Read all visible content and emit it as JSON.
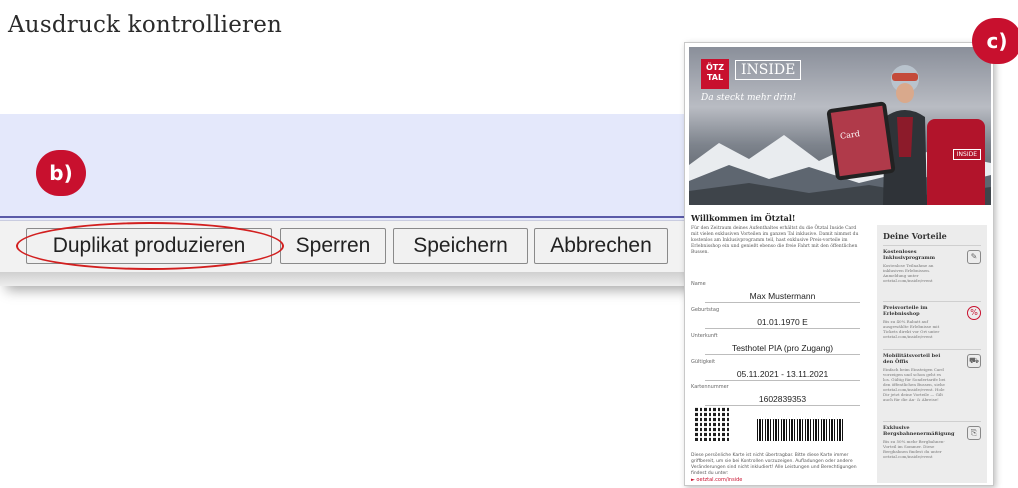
{
  "page": {
    "title": "Ausdruck kontrollieren"
  },
  "badges": {
    "b": "b)",
    "c": "c)"
  },
  "toolbar": {
    "duplicate_label": "Duplikat produzieren",
    "lock_label": "Sperren",
    "save_label": "Speichern",
    "cancel_label": "Abbrechen"
  },
  "colors": {
    "accent_red": "#c8102e",
    "panel_blue": "#e4e8fb",
    "rule_blue": "#5a5aa8"
  },
  "card": {
    "logo": "ÖTZ TAL",
    "brand": "INSIDE",
    "tagline": "Da steckt mehr drin!",
    "phone_label": "Card",
    "box_label": "INSIDE",
    "welcome": "Willkommen im Ötztal!",
    "intro": "Für den Zeitraum deines Aufenthaltes erhältst du die Ötztal Inside Card mit vielen exklusiven Vorteilen im ganzen Tal inklusive. Damit nimmst du kostenlos am Inklusivprogramm teil, hast exklusive Preis-vorteile im Erlebnisshop ein und genießt ebenso die freie Fahrt mit den öffentlichen Bussen.",
    "fields": [
      {
        "label": "Name",
        "value": "Max Mustermann"
      },
      {
        "label": "Geburtstag",
        "value": "01.01.1970   E"
      },
      {
        "label": "Unterkunft",
        "value": "Testhotel PIA (pro Zugang)"
      },
      {
        "label": "Gültigkeit",
        "value": "05.11.2021 - 13.11.2021"
      },
      {
        "label": "Kartennummer",
        "value": "1602839353"
      }
    ],
    "footer": "Diese persönliche Karte ist nicht übertragbar. Bitte diese Karte immer griffbereit, um sie bei Kontrollen vorzuzeigen. Aufladungen oder andere Veränderungen sind nicht inkludiert! Alle Leistungen und Berechtigungen findest du unter:",
    "link": "► oetztal.com/inside",
    "benefits_title": "Deine Vorteile",
    "benefits": [
      {
        "title": "Kostenloses Inklusivprogramm",
        "text": "Kostenlose Teilnahme an inklusiven Erlebnissen. Anmeldung unter oetztal.com/inside/event",
        "icon": "✎"
      },
      {
        "title": "Preisvorteile im Erlebnisshop",
        "text": "Bis zu 40% Rabatt auf ausgewählte Erlebnisse mit Tickets direkt vor Ort unter oetztal.com/inside/event",
        "icon": "%"
      },
      {
        "title": "Mobilitätsvorteil bei den Öffis",
        "text": "Einfach beim Einsteigen Card vorzeigen und schon geht es los. Gültig für Sondertarife bei den öffentlichen Bussen, siehe oetztal.com/inside/event. Hole Dir jetzt deine Vorteile — Gilt auch für die An- & Abreise!",
        "icon": "⛟"
      },
      {
        "title": "Exklusive Bergsbahnenermäßigung",
        "text": "Bis zu 50% mehr Bergbahnen-Vorteil im Sommer. Diese Bergbahnen findest du unter oetztal.com/inside/event",
        "icon": "⎘"
      }
    ]
  }
}
